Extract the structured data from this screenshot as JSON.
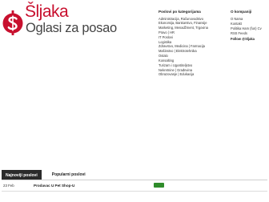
{
  "brand": {
    "name": "Šljaka",
    "tagline": "Oglasi za posao",
    "accent_color": "#c8102e",
    "logo_icon": "dollar-s-mark-icon"
  },
  "categories": {
    "title": "Poslovi po kategorijama",
    "items": [
      "Administracija, Računovodstvo",
      "Ekonomija, Bankarstvo, Finansije",
      "Marketing, Menadžment, Trgovina",
      "Pravo | HR",
      "IT Poslovi",
      "Logistika",
      "Zdravstvo, Medicina | Farmacija",
      "Mašinstvo | Elektrotehnika",
      "Ostalo",
      "Konsalting",
      "Turizam i Ugostiteljstvo",
      "Nekretnine | Građevina",
      "Obrazovanje | Edukacija"
    ]
  },
  "about": {
    "title": "O kompaniji",
    "items": [
      "O Nama",
      "Kontakt",
      "Politika Ham (fun) Cv",
      "RSS Feeds"
    ],
    "follow_label": "Follow @Sljaka"
  },
  "tabs": [
    {
      "label": "Najnoviji poslovi",
      "active": true
    },
    {
      "label": "Popularni poslovi",
      "active": false
    }
  ],
  "jobs": [
    {
      "date": "23 Feb",
      "title": "Prodavac U Pet Shop-U",
      "badge_color": "#2f8c2a"
    }
  ]
}
